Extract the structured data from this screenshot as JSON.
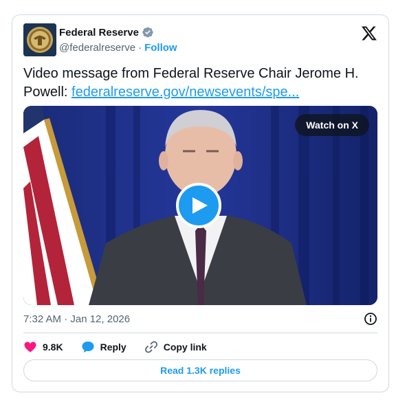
{
  "author": {
    "name": "Federal Reserve",
    "handle": "@federalreserve",
    "separator": "·",
    "follow_label": "Follow"
  },
  "tweet": {
    "text": "Video message from Federal Reserve Chair Jerome H. Powell: ",
    "link_text": "federalreserve.gov/newsevents/spe..."
  },
  "media": {
    "watch_label": "Watch on X"
  },
  "timestamp": "7:32 AM · Jan 12, 2026",
  "actions": {
    "likes_count": "9.8K",
    "reply_label": "Reply",
    "copy_link_label": "Copy link"
  },
  "read_replies_label": "Read 1.3K replies",
  "colors": {
    "accent": "#1d9bf0",
    "like": "#f91880",
    "text": "#0f1419",
    "muted": "#536471"
  },
  "icons": {
    "avatar": "federal-reserve-seal",
    "verified": "verified-badge-icon",
    "brand": "x-logo-icon",
    "play": "play-icon",
    "info": "info-icon",
    "like": "heart-icon",
    "reply": "speech-bubble-icon",
    "copy": "link-icon"
  }
}
